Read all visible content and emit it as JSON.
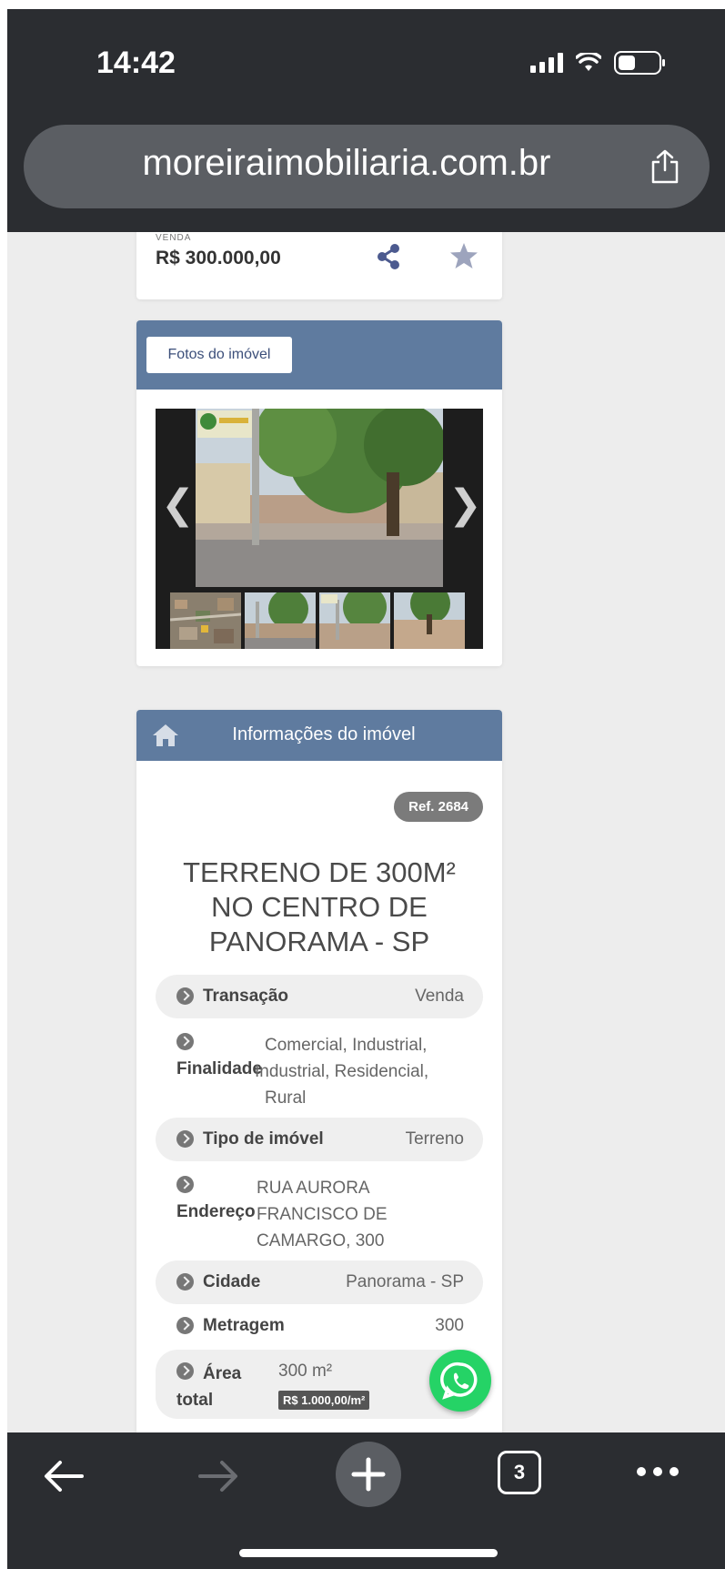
{
  "status": {
    "time": "14:42"
  },
  "browser": {
    "url": "moreiraimobiliaria.com.br",
    "tab_count": "3"
  },
  "price_card": {
    "label": "VENDA",
    "price": "R$ 300.000,00"
  },
  "photos": {
    "button_label": "Fotos do imóvel"
  },
  "info": {
    "header": "Informações do imóvel",
    "ref": "Ref. 2684",
    "title_lines": [
      "TERRENO DE 300M²",
      "NO CENTRO DE",
      "PANORAMA - SP"
    ],
    "rows": {
      "transacao": {
        "label": "Transação",
        "value": "Venda"
      },
      "finalidade": {
        "label": "Finalidade",
        "value_lines": [
          "Comercial, Industrial,",
          "Industrial, Residencial,",
          "Rural"
        ]
      },
      "tipo": {
        "label": "Tipo de imóvel",
        "value": "Terreno"
      },
      "endereco": {
        "label": "Endereço",
        "value_lines": [
          "RUA AURORA",
          "FRANCISCO DE",
          "CAMARGO, 300"
        ]
      },
      "cidade": {
        "label": "Cidade",
        "value": "Panorama - SP"
      },
      "metragem": {
        "label": "Metragem",
        "value": "300"
      },
      "area": {
        "label_lines": [
          "Área",
          "total"
        ],
        "value": "300 m²",
        "price_per_m2": "R$ 1.000,00/m²"
      }
    }
  },
  "colors": {
    "header_blue": "#5f7b9f",
    "bar_dark": "#2b2d31",
    "whatsapp": "#25d366"
  },
  "icons": [
    "share-icon",
    "star-icon",
    "home-icon",
    "whatsapp-icon",
    "back-icon",
    "forward-icon",
    "plus-icon",
    "more-icon"
  ]
}
